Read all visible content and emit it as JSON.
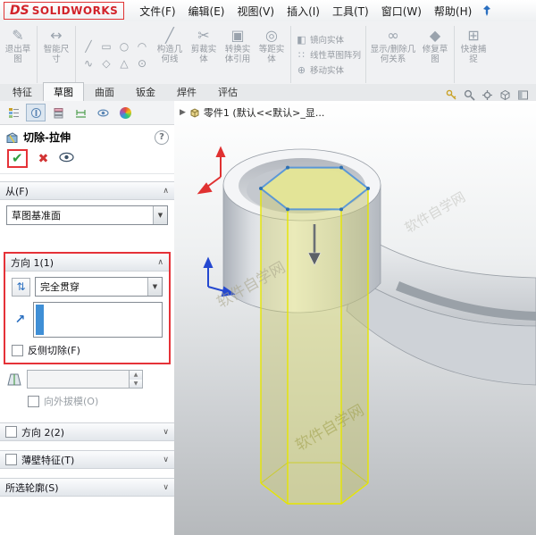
{
  "menubar": {
    "logo_prefix": "DS",
    "logo_text": "SOLIDWORKS",
    "items": [
      "文件(F)",
      "编辑(E)",
      "视图(V)",
      "插入(I)",
      "工具(T)",
      "窗口(W)",
      "帮助(H)"
    ]
  },
  "ribbon": {
    "exit_sketch": "退出草图",
    "smart_dimension": "智能尺寸",
    "construction_geometry": "构造几何线",
    "trim_entities": "剪裁实体",
    "convert_entities": "转换实体引用",
    "offset_entities": "等距实体",
    "mirror_entities": "镜向实体",
    "linear_sketch_pattern": "线性草图阵列",
    "move_entities": "移动实体",
    "display_delete_relations": "显示/删除几何关系",
    "repair_sketch": "修复草图",
    "quick_snaps": "快速捕捉"
  },
  "tabs": {
    "items": [
      "特征",
      "草图",
      "曲面",
      "钣金",
      "焊件",
      "评估"
    ],
    "active": "草图"
  },
  "property_manager": {
    "title": "切除-拉伸",
    "from": {
      "header": "从(F)",
      "value": "草图基准面"
    },
    "direction1": {
      "header": "方向 1(1)",
      "end_condition": "完全贯穿",
      "flip_side_label": "反侧切除(F)",
      "draft_value": "",
      "draft_outward_label": "向外拔模(O)"
    },
    "direction2": {
      "header": "方向 2(2)"
    },
    "thin_feature": {
      "header": "薄壁特征(T)"
    },
    "selected_contours": {
      "header": "所选轮廓(S)"
    }
  },
  "viewport": {
    "breadcrumb": "零件1 (默认<<默认>_显...",
    "watermark": "软件自学网"
  },
  "colors": {
    "annotation_red": "#e53238",
    "selection_blue": "#3f8fd6",
    "preview_yellow": "#e6e600",
    "sketch_blue": "#4a90d9",
    "logo_red": "#d2232a"
  }
}
